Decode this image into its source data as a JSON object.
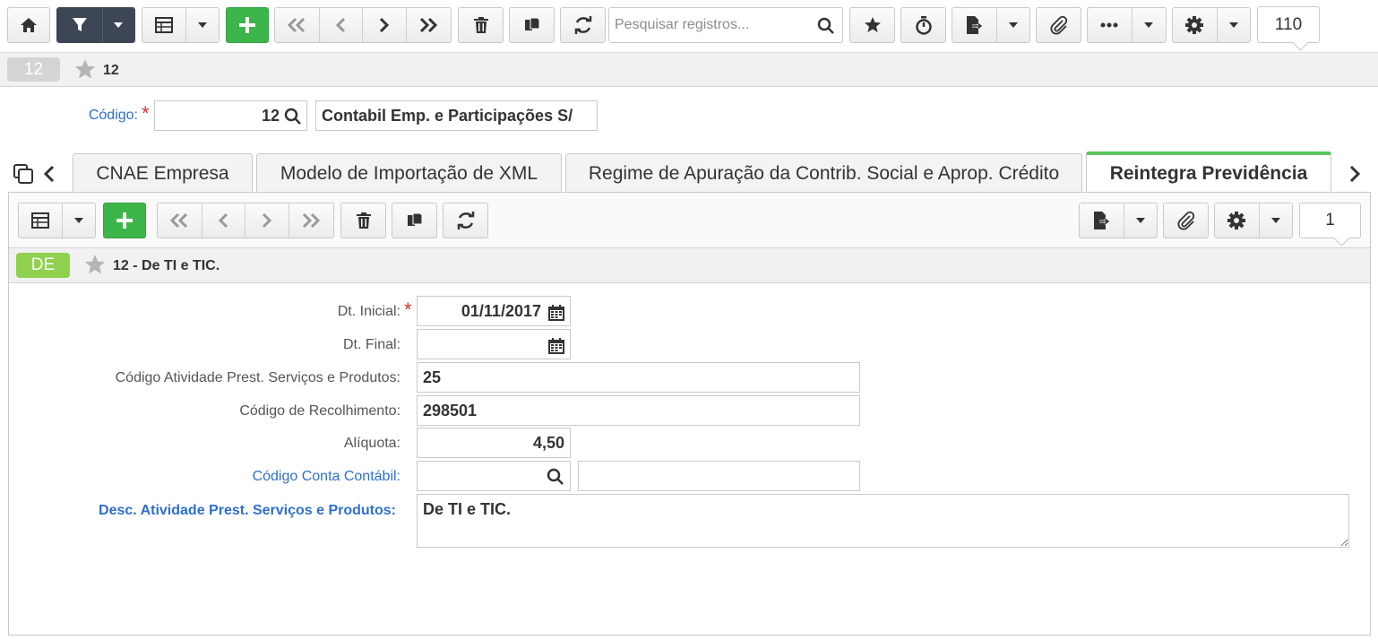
{
  "toolbar": {
    "search_placeholder": "Pesquisar registros...",
    "record_count": "110"
  },
  "record": {
    "badge": "12",
    "title": "12"
  },
  "header_form": {
    "codigo_label": "Código:",
    "codigo_value": "12",
    "company_name": "Contabil Emp. e Participações S/"
  },
  "tabs": [
    {
      "label": "CNAE Empresa"
    },
    {
      "label": "Modelo de Importação de XML"
    },
    {
      "label": "Regime de Apuração da Contrib. Social e Aprop. Crédito"
    },
    {
      "label": "Reintegra Previdência"
    }
  ],
  "panel": {
    "record_count": "1",
    "badge": "DE",
    "title": "12 - De TI e TIC."
  },
  "form": {
    "dt_inicial_label": "Dt. Inicial:",
    "dt_inicial_value": "01/11/2017",
    "dt_final_label": "Dt. Final:",
    "dt_final_value": "",
    "cod_atividade_label": "Código Atividade Prest. Serviços e Produtos:",
    "cod_atividade_value": "25",
    "cod_recolhimento_label": "Código de Recolhimento:",
    "cod_recolhimento_value": "298501",
    "aliquota_label": "Alíquota:",
    "aliquota_value": "4,50",
    "conta_contabil_label": "Código Conta Contábil:",
    "conta_contabil_value": "",
    "conta_contabil_desc": "",
    "desc_atividade_label": "Desc. Atividade Prest. Serviços e Produtos:",
    "desc_atividade_value": "De TI e TIC."
  },
  "colors": {
    "accent_green": "#3cb54a",
    "tab_active_border": "#5cc55c",
    "badge_green": "#8fd14f",
    "link_blue": "#2f6fcf",
    "required_red": "#d9352c",
    "dark_button": "#3d4654"
  }
}
